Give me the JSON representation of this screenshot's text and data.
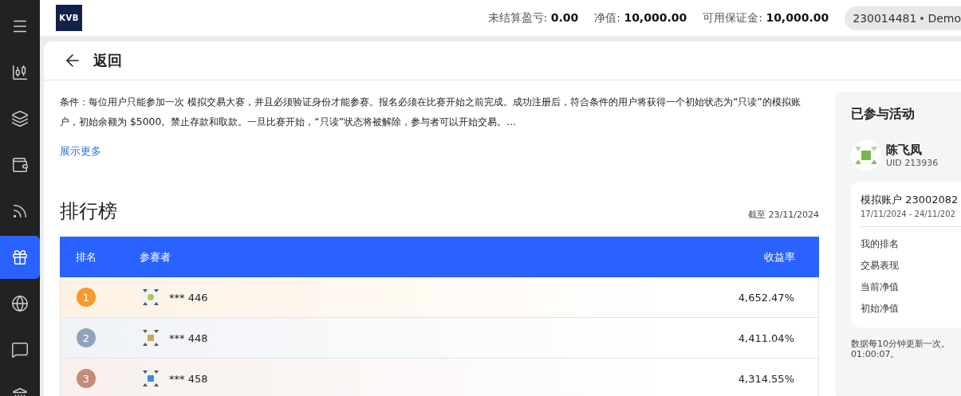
{
  "sidebar": {
    "items": [
      {
        "selected": false
      },
      {
        "selected": false
      },
      {
        "selected": false
      },
      {
        "selected": false
      },
      {
        "selected": false
      },
      {
        "selected": true
      },
      {
        "selected": false
      },
      {
        "selected": false
      },
      {
        "selected": false
      }
    ]
  },
  "topbar": {
    "logo": "KVB",
    "stats": [
      {
        "label": "未结算盈亏:",
        "value": "0.00"
      },
      {
        "label": "净值:",
        "value": "10,000.00"
      },
      {
        "label": "可用保证金:",
        "value": "10,000.00"
      }
    ],
    "account": "230014481",
    "account_type": "Demo"
  },
  "header": {
    "back": "返回"
  },
  "description": "条件：每位用户只能参加一次 模拟交易大赛，并且必须验证身份才能参赛。报名必须在比赛开始之前完成。成功注册后，符合条件的用户将获得一个初始状态为“只读”的模拟账户，初始余额为 $5000。禁止存款和取款。一旦比赛开始，“只读”状态将被解除，参与者可以开始交易。...",
  "show_more": "展示更多",
  "leaderboard": {
    "title": "排行榜",
    "as_of": "截至 23/11/2024",
    "columns": [
      "排名",
      "参赛者",
      "收益率"
    ],
    "rows": [
      {
        "rank": "1",
        "color": "#f7992b",
        "name": "*** 446",
        "return": "4,652.47%"
      },
      {
        "rank": "2",
        "color": "#8fa3bd",
        "name": "*** 448",
        "return": "4,411.04%"
      },
      {
        "rank": "3",
        "color": "#c28b7a",
        "name": "*** 458",
        "return": "4,314.55%"
      }
    ]
  },
  "activity": {
    "title": "已参与活动",
    "user": "陈飞凤",
    "uid": "UID 213936",
    "account": "模拟账户 23002082",
    "period": "17/11/2024 - 24/11/202",
    "metrics": [
      "我的排名",
      "交易表现",
      "当前净值",
      "初始净值"
    ],
    "note": [
      "数据每10分钟更新一次。",
      "01:00:07。"
    ]
  }
}
